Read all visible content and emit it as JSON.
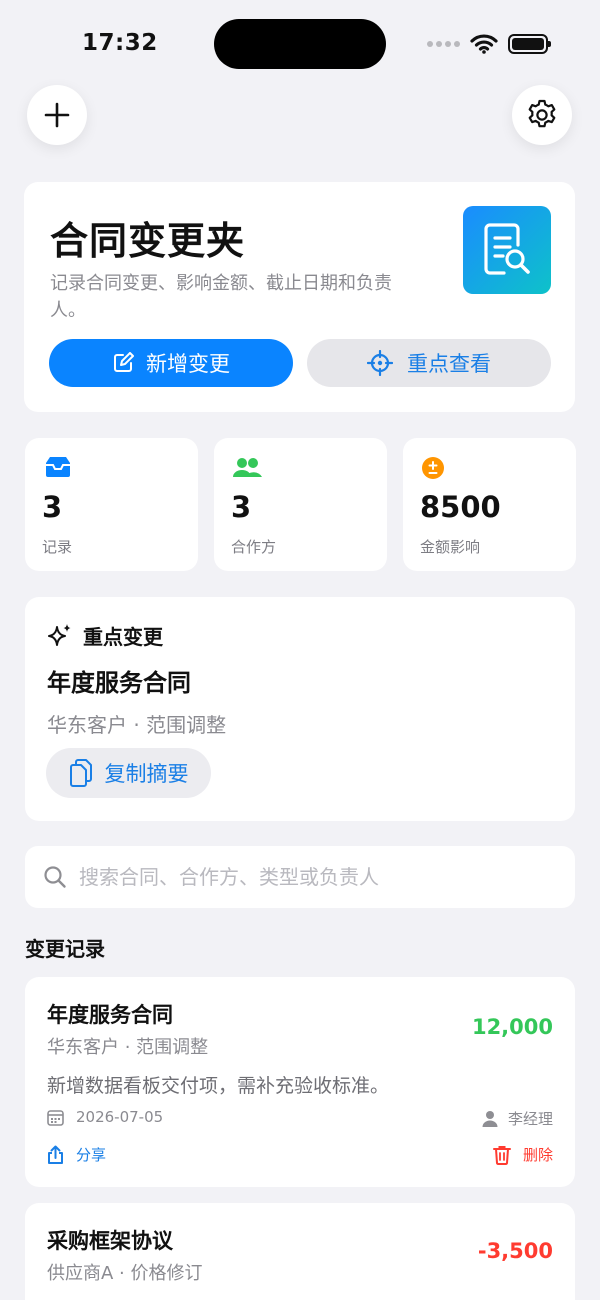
{
  "status_bar": {
    "time": "17:32"
  },
  "header": {
    "add_icon": "plus-icon",
    "settings_icon": "gear-icon"
  },
  "hero": {
    "title": "合同变更夹",
    "description": "记录合同变更、影响金额、截止日期和负责人。",
    "badge_icon": "document-search-icon",
    "primary_button": "新增变更",
    "secondary_button": "重点查看"
  },
  "stats": [
    {
      "value": "3",
      "label": "记录",
      "icon": "tray-icon",
      "color": "#0a84ff"
    },
    {
      "value": "3",
      "label": "合作方",
      "icon": "people-icon",
      "color": "#34c759"
    },
    {
      "value": "8500",
      "label": "金额影响",
      "icon": "plus-minus-icon",
      "color": "#ff9500"
    }
  ],
  "focus": {
    "heading": "重点变更",
    "title": "年度服务合同",
    "subtitle": "华东客户 · 范围调整",
    "copy_button": "复制摘要"
  },
  "search": {
    "placeholder": "搜索合同、合作方、类型或负责人",
    "value": ""
  },
  "records_section": {
    "title": "变更记录"
  },
  "records": [
    {
      "title": "年度服务合同",
      "subtitle": "华东客户 · 范围调整",
      "amount": "12,000",
      "amount_color": "#34c759",
      "note": "新增数据看板交付项，需补充验收标准。",
      "date": "2026-07-05",
      "owner": "李经理",
      "share_label": "分享",
      "delete_label": "删除"
    },
    {
      "title": "采购框架协议",
      "subtitle": "供应商A · 价格修订",
      "amount": "-3,500",
      "amount_color": "#ff3b30"
    }
  ],
  "colors": {
    "accent": "#0a84ff",
    "positive": "#34c759",
    "negative": "#ff3b30",
    "warning": "#ff9500"
  }
}
